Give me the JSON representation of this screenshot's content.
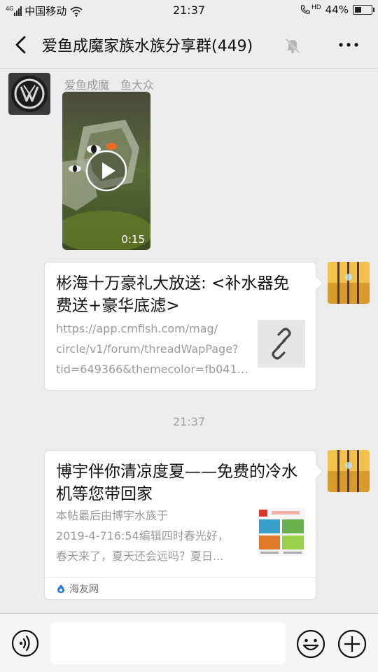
{
  "status_bar": {
    "signal_label": "4G",
    "carrier": "中国移动",
    "time": "21:37",
    "hd_label": "HD",
    "battery_percent": "44%",
    "battery_level": 0.44
  },
  "nav": {
    "title": "爱鱼成魔家族水族分享群(449)"
  },
  "messages": {
    "video_message": {
      "sender_name": "爱鱼成魔　鱼大众",
      "duration": "0:15"
    },
    "link_card_1": {
      "title": "彬海十万豪礼大放送: <补水器免费送+豪华底滤>",
      "desc_lines": [
        "https://app.cmfish.com/mag/",
        "circle/v1/forum/threadWapPage?",
        "tid=649366&themecolor=fb041d..."
      ]
    },
    "timestamp": "21:37",
    "link_card_2": {
      "title": "博宇伴你清凉度夏——免费的冷水机等您带回家",
      "desc_lines": [
        "本帖最后由博宇水族于",
        "2019-4-716:54编辑四时春光好，",
        "春天来了，夏天还会远吗？夏日..."
      ],
      "source": "海友网"
    }
  },
  "input_bar": {
    "placeholder": ""
  },
  "colors": {
    "background": "#ececec",
    "card": "#ffffff",
    "muted_text": "#9a9a9a"
  }
}
